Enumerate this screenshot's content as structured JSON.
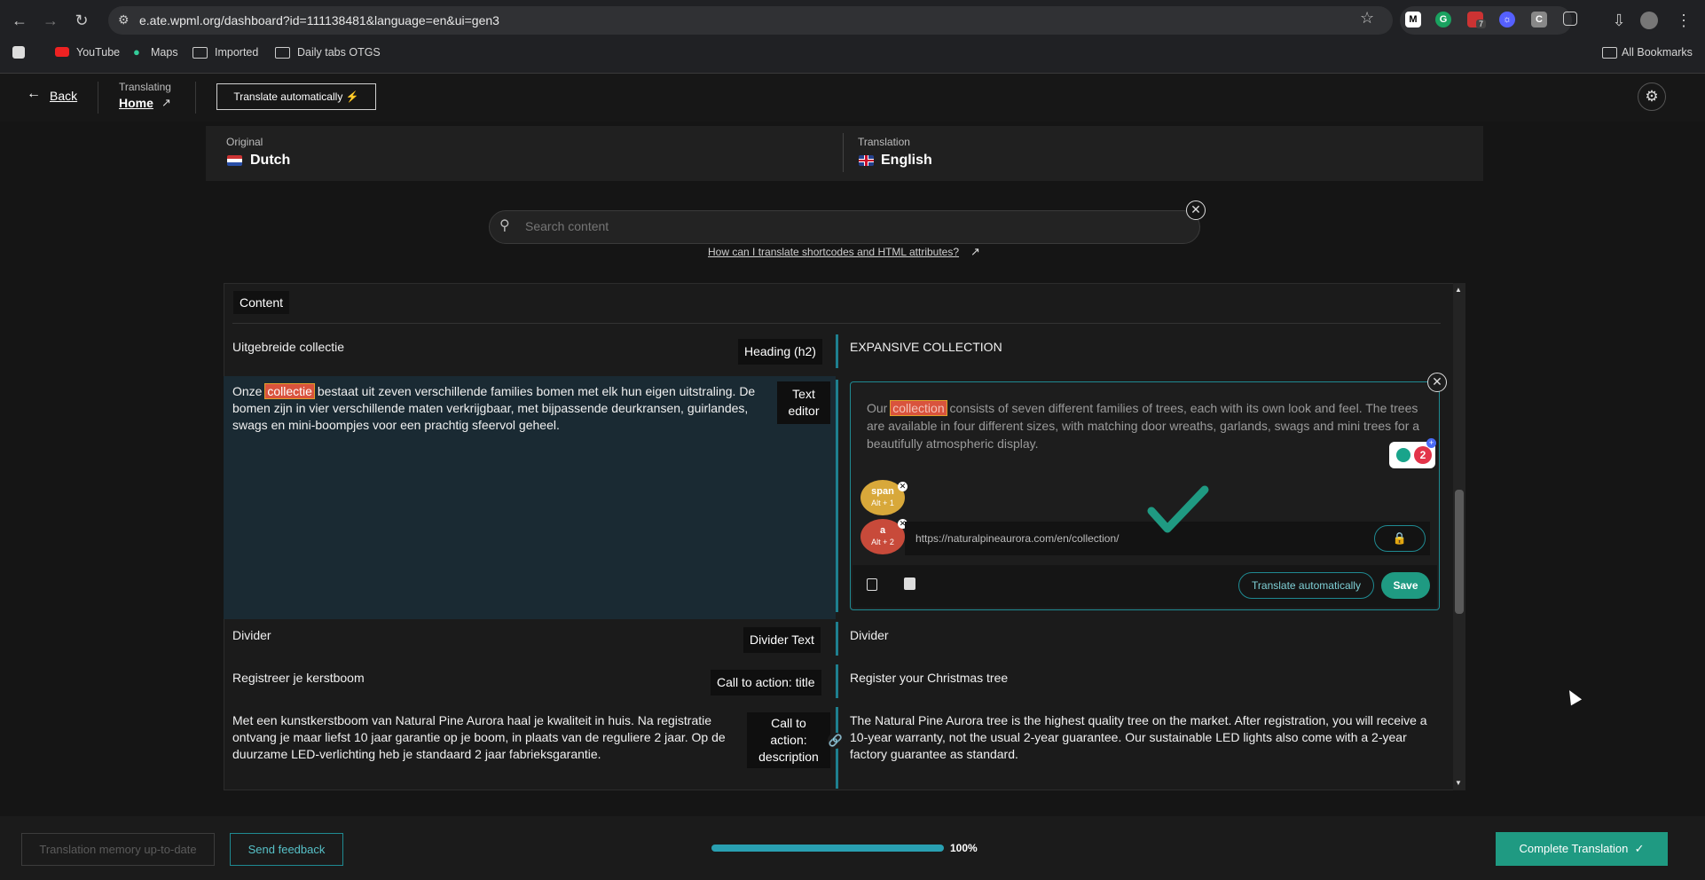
{
  "browser": {
    "url": "e.ate.wpml.org/dashboard?id=111138481&language=en&ui=gen3",
    "extension_badge": "7",
    "bookmarks": [
      "YouTube",
      "Maps",
      "Imported",
      "Daily tabs OTGS"
    ],
    "all_bookmarks": "All Bookmarks"
  },
  "header": {
    "back": "Back",
    "translating_label": "Translating",
    "page_name": "Home",
    "translate_automatically": "Translate automatically"
  },
  "languages": {
    "original_label": "Original",
    "original": "Dutch",
    "translation_label": "Translation",
    "translation": "English"
  },
  "search": {
    "placeholder": "Search content",
    "help_link": "How can I translate shortcodes and HTML attributes?"
  },
  "content": {
    "section_label": "Content",
    "rows": [
      {
        "source": "Uitgebreide collectie",
        "type": "Heading (h2)",
        "target": "EXPANSIVE COLLECTION"
      },
      {
        "source_before": "Onze ",
        "source_highlight": "collectie",
        "source_after": " bestaat uit zeven verschillende families bomen met elk hun eigen uitstraling. De bomen zijn in vier verschillende maten verkrijgbaar, met bijpassende deurkransen, guirlandes, swags en mini-boompjes voor een prachtig sfeervol geheel.",
        "type": "Text editor",
        "target_before": "Our ",
        "target_highlight": "collection",
        "target_after": " consists of seven different families of trees, each with its own look and feel. The trees are available in four different sizes, with matching door wreaths, garlands, swags and mini trees for a beautifully atmospheric display."
      },
      {
        "source": "Divider",
        "type": "Divider Text",
        "target": "Divider"
      },
      {
        "source": "Registreer je kerstboom",
        "type": "Call to action: title",
        "target": "Register your Christmas tree"
      },
      {
        "source": "Met een kunstkerstboom van Natural Pine Aurora haal je kwaliteit in huis. Na registratie ontvang je maar liefst 10 jaar garantie op je boom, in plaats van de reguliere 2 jaar. Op de duurzame LED-verlichting heb je standaard 2 jaar fabrieksgarantie.",
        "type": "Call to action: description",
        "target": "The Natural Pine Aurora tree is the highest quality tree on the market. After registration, you will receive a 10-year warranty, not the usual 2-year guarantee. Our sustainable LED lights also come with a 2-year factory guarantee as standard."
      }
    ]
  },
  "editor": {
    "tag1_name": "span",
    "tag1_shortcut": "Alt + 1",
    "tag2_name": "a",
    "tag2_shortcut": "Alt + 2",
    "link_url": "https://naturalpineaurora.com/en/collection/",
    "grammar_count": "2",
    "translate_automatically": "Translate automatically",
    "save": "Save"
  },
  "footer": {
    "translation_memory": "Translation memory up-to-date",
    "send_feedback": "Send feedback",
    "progress_value": 100,
    "progress_label": "100%",
    "complete": "Complete Translation"
  }
}
